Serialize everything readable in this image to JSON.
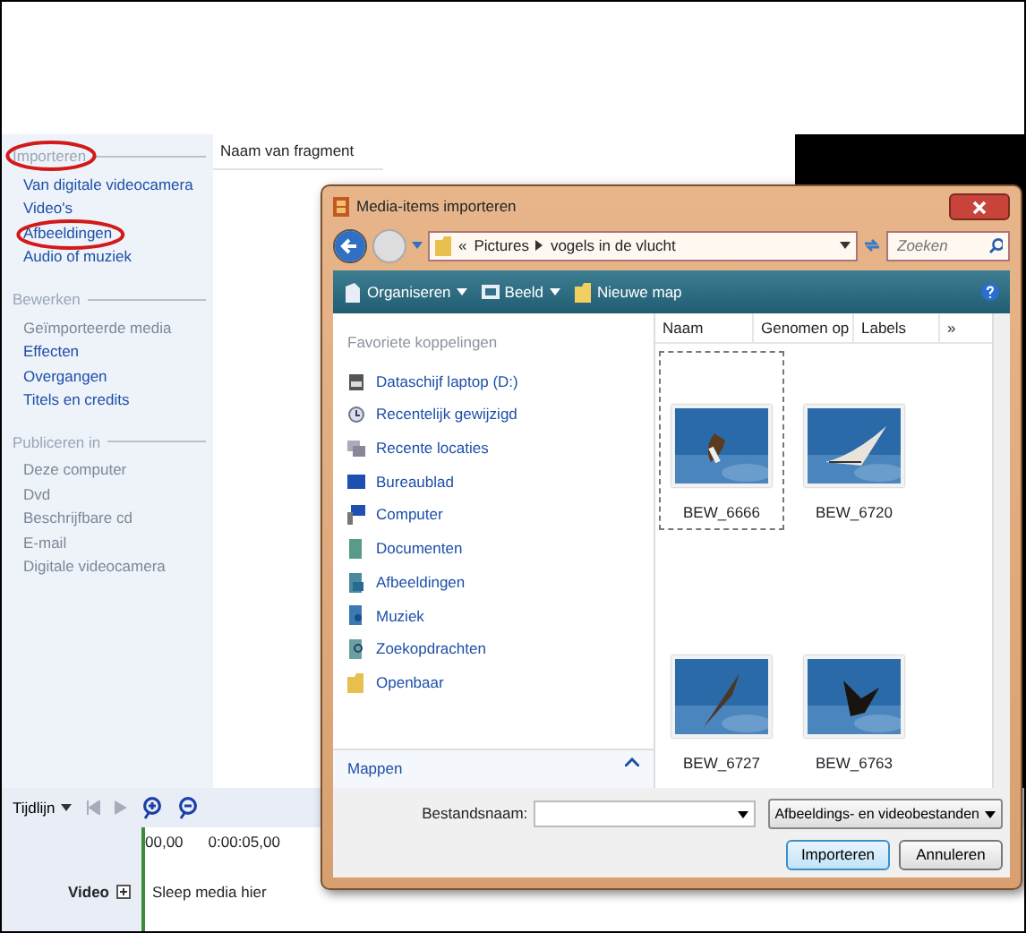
{
  "tasks": [
    {
      "heading": "Importeren",
      "circled": true,
      "items": [
        {
          "label": "Van digitale videocamera",
          "enabled": true,
          "circled": false
        },
        {
          "label": "Video's",
          "enabled": true,
          "circled": false
        },
        {
          "label": "Afbeeldingen",
          "enabled": true,
          "circled": true
        },
        {
          "label": "Audio of muziek",
          "enabled": true,
          "circled": false
        }
      ]
    },
    {
      "heading": "Bewerken",
      "circled": false,
      "items": [
        {
          "label": "Geïmporteerde media",
          "enabled": false,
          "circled": false
        },
        {
          "label": "Effecten",
          "enabled": true,
          "circled": false
        },
        {
          "label": "Overgangen",
          "enabled": true,
          "circled": false
        },
        {
          "label": "Titels en credits",
          "enabled": true,
          "circled": false
        }
      ]
    },
    {
      "heading": "Publiceren in",
      "circled": false,
      "items": [
        {
          "label": "Deze computer",
          "enabled": false,
          "circled": false
        },
        {
          "label": "Dvd",
          "enabled": false,
          "circled": false
        },
        {
          "label": "Beschrijfbare cd",
          "enabled": false,
          "circled": false
        },
        {
          "label": "E-mail",
          "enabled": false,
          "circled": false
        },
        {
          "label": "Digitale videocamera",
          "enabled": false,
          "circled": false
        }
      ]
    }
  ],
  "content_header": "Naam van fragment",
  "timeline": {
    "mode": "Tijdlijn",
    "ruler": [
      "00,00",
      "0:00:05,00"
    ],
    "track": "Video",
    "drop_hint": "Sleep media hier"
  },
  "dialog": {
    "title": "Media-items importeren",
    "breadcrumb_lead": "«",
    "path": [
      "Pictures",
      "vogels in de vlucht"
    ],
    "search": {
      "placeholder": "Zoeken"
    },
    "toolbar": [
      "Organiseren",
      "Beeld",
      "Nieuwe map"
    ],
    "favorites_title": "Favoriete koppelingen",
    "favorites": [
      {
        "label": "Dataschijf laptop (D:)",
        "kind": "drive"
      },
      {
        "label": "Recentelijk gewijzigd",
        "kind": "recent"
      },
      {
        "label": "Recente locaties",
        "kind": "places"
      },
      {
        "label": "Bureaublad",
        "kind": "desktop"
      },
      {
        "label": "Computer",
        "kind": "computer"
      },
      {
        "label": "Documenten",
        "kind": "docs"
      },
      {
        "label": "Afbeeldingen",
        "kind": "pics"
      },
      {
        "label": "Muziek",
        "kind": "music"
      },
      {
        "label": "Zoekopdrachten",
        "kind": "search"
      },
      {
        "label": "Openbaar",
        "kind": "folder"
      }
    ],
    "folders_label": "Mappen",
    "columns": [
      "Naam",
      "Genomen op",
      "Labels",
      "»"
    ],
    "files": [
      {
        "name": "BEW_6666",
        "selected": true
      },
      {
        "name": "BEW_6720",
        "selected": false
      },
      {
        "name": "BEW_6727",
        "selected": false
      },
      {
        "name": "BEW_6763",
        "selected": false
      }
    ],
    "filename_label": "Bestandsnaam:",
    "file_type": "Afbeeldings- en videobestanden",
    "buttons": [
      {
        "label": "Importeren",
        "default": true
      },
      {
        "label": "Annuleren",
        "default": false
      }
    ]
  }
}
